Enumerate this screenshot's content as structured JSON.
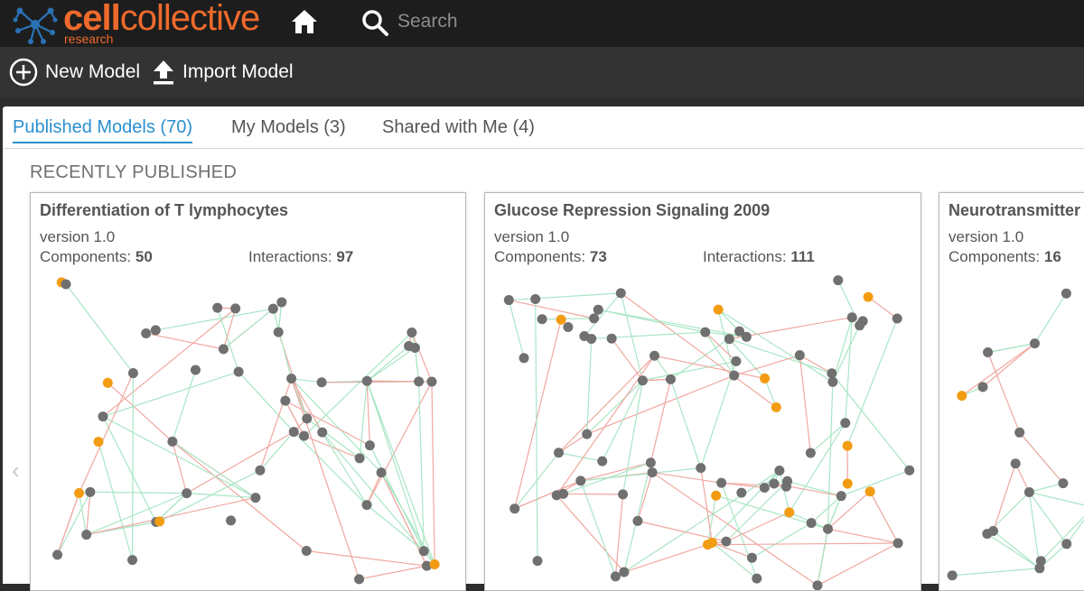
{
  "brand": {
    "name_bold": "cell",
    "name_rest": "collective",
    "subtitle": "research",
    "color": "#ee6a2c"
  },
  "header": {
    "home_icon": "home-icon",
    "search": {
      "icon": "search-icon",
      "placeholder": "Search"
    }
  },
  "toolbar": {
    "new_model_label": "New Model",
    "new_model_icon": "plus-circle-icon",
    "import_model_label": "Import Model",
    "import_model_icon": "upload-icon"
  },
  "tabs": [
    {
      "label": "Published Models (70)",
      "active": true
    },
    {
      "label": "My Models (3)",
      "active": false
    },
    {
      "label": "Shared with Me (4)",
      "active": false
    }
  ],
  "section_title": "RECENTLY PUBLISHED",
  "carousel": {
    "prev_icon": "chevron-left-icon",
    "prev_glyph": "‹"
  },
  "colors": {
    "accent": "#2b8fcf",
    "node_gray": "#707070",
    "node_orange": "#f39c12",
    "edge_green": "#a8e6c5",
    "edge_red": "#f0a8a0"
  },
  "labels": {
    "components": "Components:",
    "interactions": "Interactions:"
  },
  "models": [
    {
      "title": "Differentiation of T lymphocytes",
      "version": "version 1.0",
      "components": "50",
      "interactions": "97"
    },
    {
      "title": "Glucose Repression Signaling 2009",
      "version": "version 1.0",
      "components": "73",
      "interactions": "111"
    },
    {
      "title": "Neurotransmitter",
      "version": "version 1.0",
      "components": "16"
    }
  ]
}
